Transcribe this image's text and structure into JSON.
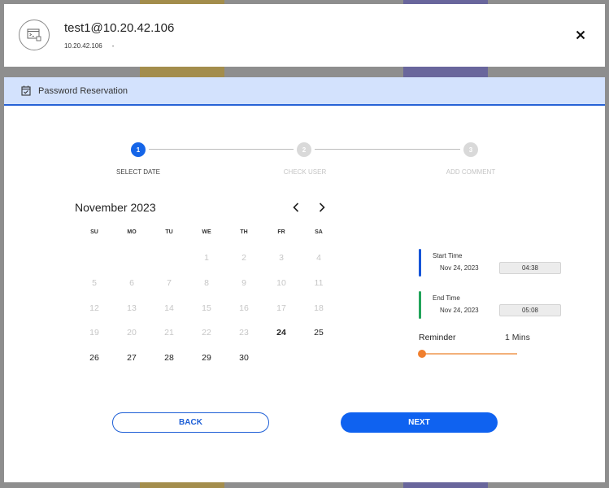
{
  "header": {
    "title": "test1@10.20.42.106",
    "ip": "10.20.42.106",
    "separator": "-"
  },
  "dialog": {
    "title": "Password Reservation"
  },
  "stepper": {
    "steps": [
      {
        "number": "1",
        "label": "SELECT DATE",
        "active": true
      },
      {
        "number": "2",
        "label": "CHECK USER",
        "active": false
      },
      {
        "number": "3",
        "label": "ADD COMMENT",
        "active": false
      }
    ]
  },
  "calendar": {
    "month_label": "November 2023",
    "weekdays": [
      "SU",
      "MO",
      "TU",
      "WE",
      "TH",
      "FR",
      "SA"
    ],
    "weeks": [
      [
        "",
        "",
        "",
        "1",
        "2",
        "3",
        "4"
      ],
      [
        "5",
        "6",
        "7",
        "8",
        "9",
        "10",
        "11"
      ],
      [
        "12",
        "13",
        "14",
        "15",
        "16",
        "17",
        "18"
      ],
      [
        "19",
        "20",
        "21",
        "22",
        "23",
        "24",
        "25"
      ],
      [
        "26",
        "27",
        "28",
        "29",
        "30",
        "",
        ""
      ]
    ],
    "selected_day": "24",
    "enabled_days": [
      "24",
      "25",
      "26",
      "27",
      "28",
      "29",
      "30"
    ]
  },
  "start_time": {
    "label": "Start Time",
    "date": "Nov 24, 2023",
    "time": "04:38",
    "color": "#1655d8"
  },
  "end_time": {
    "label": "End Time",
    "date": "Nov 24, 2023",
    "time": "05:08",
    "color": "#22a45a"
  },
  "reminder": {
    "label": "Reminder",
    "value": "1 Mins",
    "level": 0
  },
  "buttons": {
    "back": "BACK",
    "next": "NEXT"
  }
}
